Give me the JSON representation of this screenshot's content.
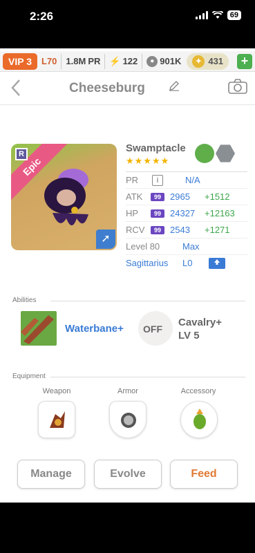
{
  "status_bar": {
    "time": "2:26",
    "battery": "69"
  },
  "currency_bar": {
    "vip": "VIP 3",
    "level": "L70",
    "power": "1.8M",
    "power_unit": "PR",
    "energy": "122",
    "paws": "901K",
    "gold": "431",
    "plus": "+"
  },
  "header": {
    "title": "Cheeseburg",
    "back_icon": "chevron-left-icon",
    "edit_icon": "pencil-icon",
    "camera_icon": "camera-icon"
  },
  "portrait": {
    "rarity": "Epic",
    "rarity_letter": "R"
  },
  "monster": {
    "name": "Swamptacle",
    "stars": "★★★★★",
    "elements": [
      "leaf",
      "rock"
    ],
    "pr_label": "PR",
    "pr_value": "N/A",
    "stats": [
      {
        "label": "ATK",
        "badge": "99",
        "value": "2965",
        "bonus": "+1512"
      },
      {
        "label": "HP",
        "badge": "99",
        "value": "24327",
        "bonus": "+12163"
      },
      {
        "label": "RCV",
        "badge": "99",
        "value": "2543",
        "bonus": "+1271"
      }
    ],
    "level_label": "Level 80",
    "level_value": "Max",
    "sign": "Sagittarius",
    "sign_level": "L0"
  },
  "abilities": {
    "section_label": "Abilities",
    "items": [
      {
        "name": "Waterbane+"
      },
      {
        "state": "OFF",
        "name": "Cavalry+",
        "level": "LV 5"
      }
    ]
  },
  "equipment": {
    "section_label": "Equipment",
    "slots": [
      {
        "label": "Weapon"
      },
      {
        "label": "Armor"
      },
      {
        "label": "Accessory"
      }
    ]
  },
  "actions": {
    "manage": "Manage",
    "evolve": "Evolve",
    "feed": "Feed"
  },
  "colors": {
    "vip": "#ea6a2a",
    "accent_blue": "#3a7bd5",
    "bonus_green": "#3ca54b",
    "feed": "#e07a33",
    "badge_purple": "#6b46c1"
  }
}
